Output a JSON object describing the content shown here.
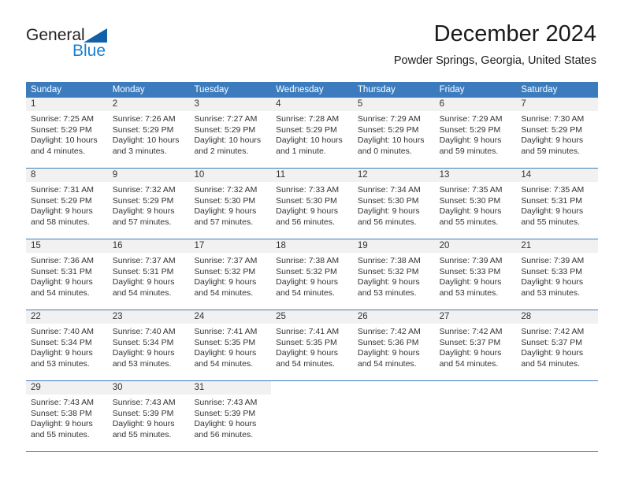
{
  "logo": {
    "primary_text": "General",
    "secondary_text": "Blue",
    "primary_color": "#231f20",
    "secondary_color": "#1b7fd4",
    "triangle_color": "#1261a8",
    "icon": "triangle-icon"
  },
  "header": {
    "title": "December 2024",
    "subtitle": "Powder Springs, Georgia, United States"
  },
  "theme": {
    "header_bg": "#3c7cbe",
    "header_text": "#ffffff",
    "daynum_bg": "#f1f1f1",
    "row_divider": "#3c7cbe",
    "body_text": "#333333"
  },
  "weekdays": [
    "Sunday",
    "Monday",
    "Tuesday",
    "Wednesday",
    "Thursday",
    "Friday",
    "Saturday"
  ],
  "weeks": [
    [
      {
        "day": "1",
        "sunrise": "Sunrise: 7:25 AM",
        "sunset": "Sunset: 5:29 PM",
        "daylight_1": "Daylight: 10 hours",
        "daylight_2": "and 4 minutes."
      },
      {
        "day": "2",
        "sunrise": "Sunrise: 7:26 AM",
        "sunset": "Sunset: 5:29 PM",
        "daylight_1": "Daylight: 10 hours",
        "daylight_2": "and 3 minutes."
      },
      {
        "day": "3",
        "sunrise": "Sunrise: 7:27 AM",
        "sunset": "Sunset: 5:29 PM",
        "daylight_1": "Daylight: 10 hours",
        "daylight_2": "and 2 minutes."
      },
      {
        "day": "4",
        "sunrise": "Sunrise: 7:28 AM",
        "sunset": "Sunset: 5:29 PM",
        "daylight_1": "Daylight: 10 hours",
        "daylight_2": "and 1 minute."
      },
      {
        "day": "5",
        "sunrise": "Sunrise: 7:29 AM",
        "sunset": "Sunset: 5:29 PM",
        "daylight_1": "Daylight: 10 hours",
        "daylight_2": "and 0 minutes."
      },
      {
        "day": "6",
        "sunrise": "Sunrise: 7:29 AM",
        "sunset": "Sunset: 5:29 PM",
        "daylight_1": "Daylight: 9 hours",
        "daylight_2": "and 59 minutes."
      },
      {
        "day": "7",
        "sunrise": "Sunrise: 7:30 AM",
        "sunset": "Sunset: 5:29 PM",
        "daylight_1": "Daylight: 9 hours",
        "daylight_2": "and 59 minutes."
      }
    ],
    [
      {
        "day": "8",
        "sunrise": "Sunrise: 7:31 AM",
        "sunset": "Sunset: 5:29 PM",
        "daylight_1": "Daylight: 9 hours",
        "daylight_2": "and 58 minutes."
      },
      {
        "day": "9",
        "sunrise": "Sunrise: 7:32 AM",
        "sunset": "Sunset: 5:29 PM",
        "daylight_1": "Daylight: 9 hours",
        "daylight_2": "and 57 minutes."
      },
      {
        "day": "10",
        "sunrise": "Sunrise: 7:32 AM",
        "sunset": "Sunset: 5:30 PM",
        "daylight_1": "Daylight: 9 hours",
        "daylight_2": "and 57 minutes."
      },
      {
        "day": "11",
        "sunrise": "Sunrise: 7:33 AM",
        "sunset": "Sunset: 5:30 PM",
        "daylight_1": "Daylight: 9 hours",
        "daylight_2": "and 56 minutes."
      },
      {
        "day": "12",
        "sunrise": "Sunrise: 7:34 AM",
        "sunset": "Sunset: 5:30 PM",
        "daylight_1": "Daylight: 9 hours",
        "daylight_2": "and 56 minutes."
      },
      {
        "day": "13",
        "sunrise": "Sunrise: 7:35 AM",
        "sunset": "Sunset: 5:30 PM",
        "daylight_1": "Daylight: 9 hours",
        "daylight_2": "and 55 minutes."
      },
      {
        "day": "14",
        "sunrise": "Sunrise: 7:35 AM",
        "sunset": "Sunset: 5:31 PM",
        "daylight_1": "Daylight: 9 hours",
        "daylight_2": "and 55 minutes."
      }
    ],
    [
      {
        "day": "15",
        "sunrise": "Sunrise: 7:36 AM",
        "sunset": "Sunset: 5:31 PM",
        "daylight_1": "Daylight: 9 hours",
        "daylight_2": "and 54 minutes."
      },
      {
        "day": "16",
        "sunrise": "Sunrise: 7:37 AM",
        "sunset": "Sunset: 5:31 PM",
        "daylight_1": "Daylight: 9 hours",
        "daylight_2": "and 54 minutes."
      },
      {
        "day": "17",
        "sunrise": "Sunrise: 7:37 AM",
        "sunset": "Sunset: 5:32 PM",
        "daylight_1": "Daylight: 9 hours",
        "daylight_2": "and 54 minutes."
      },
      {
        "day": "18",
        "sunrise": "Sunrise: 7:38 AM",
        "sunset": "Sunset: 5:32 PM",
        "daylight_1": "Daylight: 9 hours",
        "daylight_2": "and 54 minutes."
      },
      {
        "day": "19",
        "sunrise": "Sunrise: 7:38 AM",
        "sunset": "Sunset: 5:32 PM",
        "daylight_1": "Daylight: 9 hours",
        "daylight_2": "and 53 minutes."
      },
      {
        "day": "20",
        "sunrise": "Sunrise: 7:39 AM",
        "sunset": "Sunset: 5:33 PM",
        "daylight_1": "Daylight: 9 hours",
        "daylight_2": "and 53 minutes."
      },
      {
        "day": "21",
        "sunrise": "Sunrise: 7:39 AM",
        "sunset": "Sunset: 5:33 PM",
        "daylight_1": "Daylight: 9 hours",
        "daylight_2": "and 53 minutes."
      }
    ],
    [
      {
        "day": "22",
        "sunrise": "Sunrise: 7:40 AM",
        "sunset": "Sunset: 5:34 PM",
        "daylight_1": "Daylight: 9 hours",
        "daylight_2": "and 53 minutes."
      },
      {
        "day": "23",
        "sunrise": "Sunrise: 7:40 AM",
        "sunset": "Sunset: 5:34 PM",
        "daylight_1": "Daylight: 9 hours",
        "daylight_2": "and 53 minutes."
      },
      {
        "day": "24",
        "sunrise": "Sunrise: 7:41 AM",
        "sunset": "Sunset: 5:35 PM",
        "daylight_1": "Daylight: 9 hours",
        "daylight_2": "and 54 minutes."
      },
      {
        "day": "25",
        "sunrise": "Sunrise: 7:41 AM",
        "sunset": "Sunset: 5:35 PM",
        "daylight_1": "Daylight: 9 hours",
        "daylight_2": "and 54 minutes."
      },
      {
        "day": "26",
        "sunrise": "Sunrise: 7:42 AM",
        "sunset": "Sunset: 5:36 PM",
        "daylight_1": "Daylight: 9 hours",
        "daylight_2": "and 54 minutes."
      },
      {
        "day": "27",
        "sunrise": "Sunrise: 7:42 AM",
        "sunset": "Sunset: 5:37 PM",
        "daylight_1": "Daylight: 9 hours",
        "daylight_2": "and 54 minutes."
      },
      {
        "day": "28",
        "sunrise": "Sunrise: 7:42 AM",
        "sunset": "Sunset: 5:37 PM",
        "daylight_1": "Daylight: 9 hours",
        "daylight_2": "and 54 minutes."
      }
    ],
    [
      {
        "day": "29",
        "sunrise": "Sunrise: 7:43 AM",
        "sunset": "Sunset: 5:38 PM",
        "daylight_1": "Daylight: 9 hours",
        "daylight_2": "and 55 minutes."
      },
      {
        "day": "30",
        "sunrise": "Sunrise: 7:43 AM",
        "sunset": "Sunset: 5:39 PM",
        "daylight_1": "Daylight: 9 hours",
        "daylight_2": "and 55 minutes."
      },
      {
        "day": "31",
        "sunrise": "Sunrise: 7:43 AM",
        "sunset": "Sunset: 5:39 PM",
        "daylight_1": "Daylight: 9 hours",
        "daylight_2": "and 56 minutes."
      },
      {
        "day": "",
        "sunrise": "",
        "sunset": "",
        "daylight_1": "",
        "daylight_2": ""
      },
      {
        "day": "",
        "sunrise": "",
        "sunset": "",
        "daylight_1": "",
        "daylight_2": ""
      },
      {
        "day": "",
        "sunrise": "",
        "sunset": "",
        "daylight_1": "",
        "daylight_2": ""
      },
      {
        "day": "",
        "sunrise": "",
        "sunset": "",
        "daylight_1": "",
        "daylight_2": ""
      }
    ]
  ]
}
